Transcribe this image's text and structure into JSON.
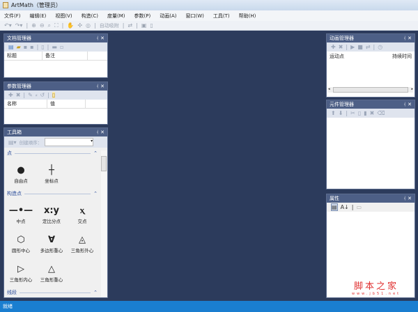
{
  "window": {
    "title": "ArtMath（管理员）"
  },
  "menu": [
    "文件(F)",
    "编辑(E)",
    "视图(V)",
    "构造(C)",
    "度量(M)",
    "参数(P)",
    "动画(A)",
    "窗口(W)",
    "工具(T)",
    "帮助(H)"
  ],
  "toolbar": {
    "auto_snap": "自动吸附"
  },
  "doc_manager": {
    "title": "文档管理器",
    "columns": [
      "标题",
      "备注"
    ]
  },
  "param_manager": {
    "title": "参数管理器",
    "columns": [
      "名称",
      "值"
    ]
  },
  "toolbox": {
    "title": "工具箱",
    "order_label": "创建顺序：",
    "sections": [
      {
        "name": "点",
        "items": [
          {
            "icon": "free-point",
            "label": "自由点"
          },
          {
            "icon": "coord-point",
            "label": "坐标点"
          }
        ]
      },
      {
        "name": "构造点",
        "items": [
          {
            "icon": "midpoint",
            "label": "中点"
          },
          {
            "icon": "ratio-point",
            "label": "定比分点"
          },
          {
            "icon": "intersection",
            "label": "交点"
          },
          {
            "icon": "circle-center",
            "label": "圆形中心"
          },
          {
            "icon": "polygon-centroid",
            "label": "多边形重心"
          },
          {
            "icon": "circumcenter",
            "label": "三角形外心"
          },
          {
            "icon": "incenter",
            "label": "三角形内心"
          },
          {
            "icon": "centroid",
            "label": "三角形重心"
          }
        ]
      },
      {
        "name": "线段",
        "items": []
      }
    ]
  },
  "anim_manager": {
    "title": "动画管理器",
    "columns": [
      "运动点",
      "持续时间"
    ]
  },
  "comp_manager": {
    "title": "元件管理器"
  },
  "properties": {
    "title": "属性"
  },
  "status": {
    "text": "就绪"
  },
  "watermark": {
    "main": "脚本之家",
    "sub": "www.jb51.net"
  }
}
